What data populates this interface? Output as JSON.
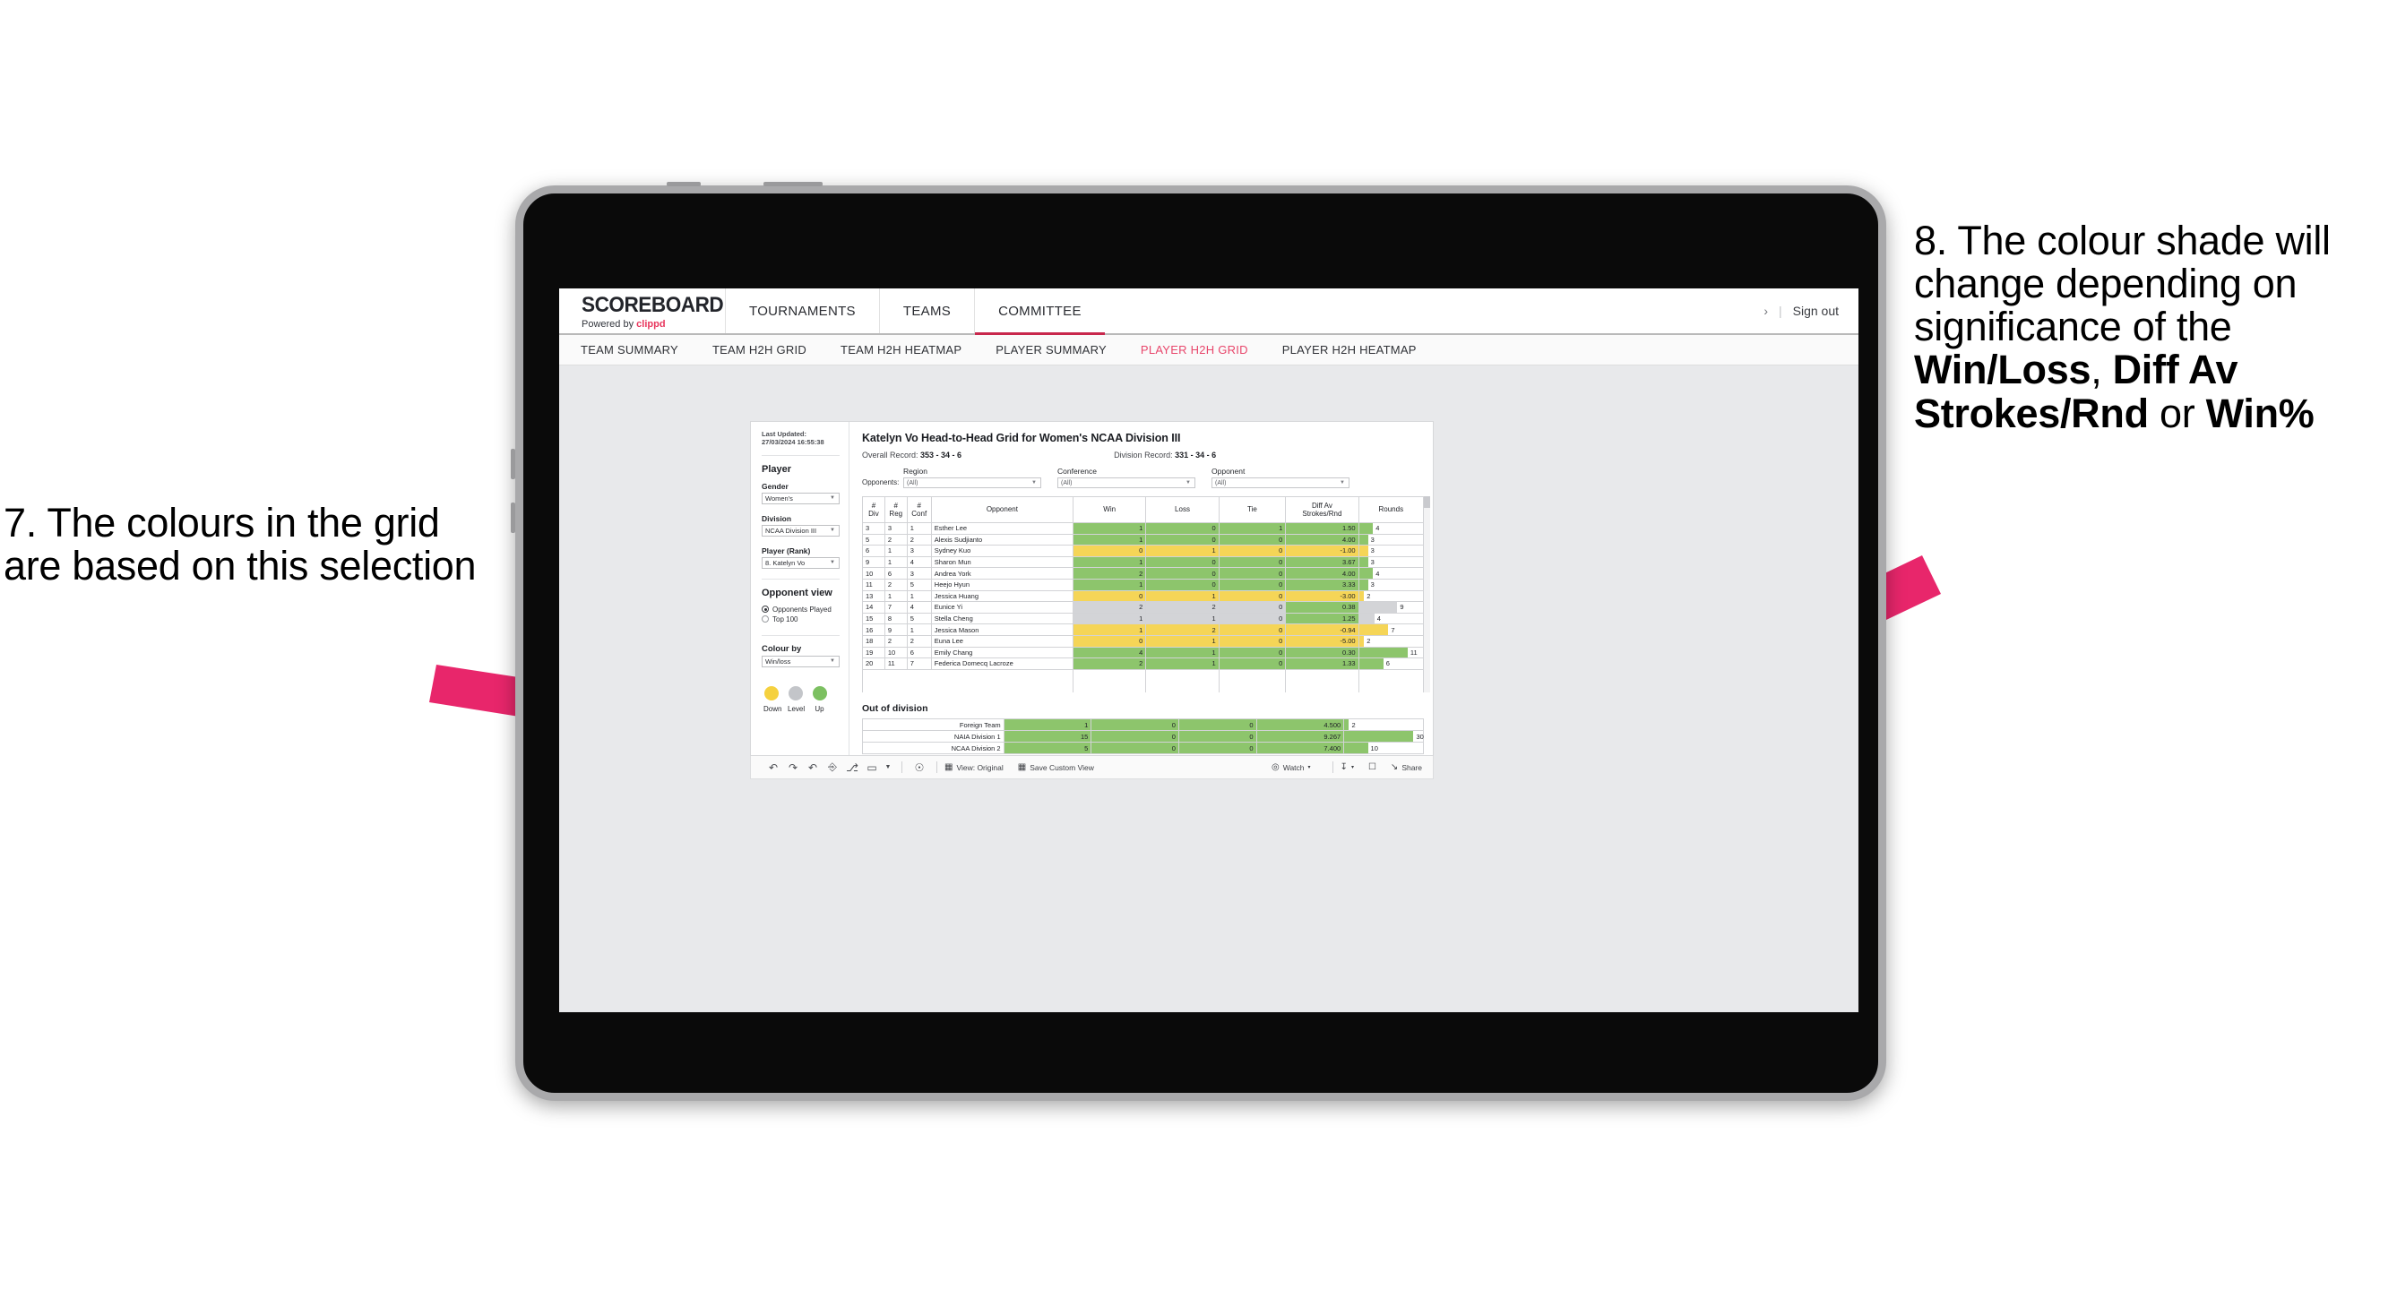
{
  "annotations": {
    "left": {
      "text": "7. The colours in the grid are based on this selection"
    },
    "right": {
      "line1": "8. The colour shade will change depending on significance of the ",
      "bold1": "Win/Loss",
      "mid1": ", ",
      "bold2": "Diff Av Strokes/Rnd",
      "mid2": " or ",
      "bold3": "Win%"
    }
  },
  "app": {
    "brand": {
      "title": "SCOREBOARD",
      "powered_by": "Powered by ",
      "clippd": "clippd"
    },
    "top_nav": [
      {
        "label": "TOURNAMENTS",
        "active": false
      },
      {
        "label": "TEAMS",
        "active": false
      },
      {
        "label": "COMMITTEE",
        "active": true
      }
    ],
    "header_right": {
      "chevron": "›",
      "pipe": "|",
      "sign_out": "Sign out"
    },
    "sub_nav": [
      {
        "label": "TEAM SUMMARY",
        "active": false
      },
      {
        "label": "TEAM H2H GRID",
        "active": false
      },
      {
        "label": "TEAM H2H HEATMAP",
        "active": false
      },
      {
        "label": "PLAYER SUMMARY",
        "active": false
      },
      {
        "label": "PLAYER H2H GRID",
        "active": true
      },
      {
        "label": "PLAYER H2H HEATMAP",
        "active": false
      }
    ]
  },
  "sidebar": {
    "last_updated": "Last Updated: 27/03/2024 16:55:38",
    "player_heading": "Player",
    "filters": [
      {
        "label": "Gender",
        "value": "Women's"
      },
      {
        "label": "Division",
        "value": "NCAA Division III"
      },
      {
        "label": "Player (Rank)",
        "value": "8. Katelyn Vo"
      }
    ],
    "opponent_view": {
      "heading": "Opponent view",
      "options": [
        {
          "label": "Opponents Played",
          "selected": true
        },
        {
          "label": "Top 100",
          "selected": false
        }
      ]
    },
    "colour_by": {
      "label": "Colour by",
      "value": "Win/loss"
    },
    "legend": [
      {
        "label": "Down",
        "color": "#f5d13f"
      },
      {
        "label": "Level",
        "color": "#c3c5c9"
      },
      {
        "label": "Up",
        "color": "#7cc061"
      }
    ]
  },
  "main": {
    "title": "Katelyn Vo Head-to-Head Grid for Women's NCAA Division III",
    "overall_record_label": "Overall Record: ",
    "overall_record_value": "353 -  34 - 6",
    "division_record_label": "Division Record: ",
    "division_record_value": "331 -  34 - 6",
    "opponents_label": "Opponents:",
    "opponent_filters": [
      {
        "label": "Region",
        "value": "(All)"
      },
      {
        "label": "Conference",
        "value": "(All)"
      },
      {
        "label": "Opponent",
        "value": "(All)"
      }
    ],
    "table_headers": [
      "#\nDiv",
      "#\nReg",
      "#\nConf",
      "Opponent",
      "Win",
      "Loss",
      "Tie",
      "Diff Av\nStrokes/Rnd",
      "Rounds"
    ],
    "rows": [
      {
        "div": "3",
        "reg": "3",
        "conf": "1",
        "opponent": "Esther Lee",
        "win": "1",
        "loss": "0",
        "tie": "1",
        "diff": "1.50",
        "rounds": "4",
        "fill": "#8dc56c",
        "bar_pct": 22
      },
      {
        "div": "5",
        "reg": "2",
        "conf": "2",
        "opponent": "Alexis Sudjianto",
        "win": "1",
        "loss": "0",
        "tie": "0",
        "diff": "4.00",
        "rounds": "3",
        "fill": "#8dc56c",
        "bar_pct": 14
      },
      {
        "div": "6",
        "reg": "1",
        "conf": "3",
        "opponent": "Sydney Kuo",
        "win": "0",
        "loss": "1",
        "tie": "0",
        "diff": "-1.00",
        "rounds": "3",
        "fill": "#f5d557",
        "bar_pct": 14
      },
      {
        "div": "9",
        "reg": "1",
        "conf": "4",
        "opponent": "Sharon Mun",
        "win": "1",
        "loss": "0",
        "tie": "0",
        "diff": "3.67",
        "rounds": "3",
        "fill": "#8dc56c",
        "bar_pct": 14
      },
      {
        "div": "10",
        "reg": "6",
        "conf": "3",
        "opponent": "Andrea York",
        "win": "2",
        "loss": "0",
        "tie": "0",
        "diff": "4.00",
        "rounds": "4",
        "fill": "#8dc56c",
        "bar_pct": 22
      },
      {
        "div": "11",
        "reg": "2",
        "conf": "5",
        "opponent": "Heejo Hyun",
        "win": "1",
        "loss": "0",
        "tie": "0",
        "diff": "3.33",
        "rounds": "3",
        "fill": "#8dc56c",
        "bar_pct": 14
      },
      {
        "div": "13",
        "reg": "1",
        "conf": "1",
        "opponent": "Jessica Huang",
        "win": "0",
        "loss": "1",
        "tie": "0",
        "diff": "-3.00",
        "rounds": "2",
        "fill": "#f5d557",
        "bar_pct": 8
      },
      {
        "div": "14",
        "reg": "7",
        "conf": "4",
        "opponent": "Eunice Yi",
        "win": "2",
        "loss": "2",
        "tie": "0",
        "diff": "0.38",
        "rounds": "9",
        "fill": "#d3d4d7",
        "bar_pct": 60,
        "diff_fill": "#8dc56c"
      },
      {
        "div": "15",
        "reg": "8",
        "conf": "5",
        "opponent": "Stella Cheng",
        "win": "1",
        "loss": "1",
        "tie": "0",
        "diff": "1.25",
        "rounds": "4",
        "fill": "#d3d4d7",
        "bar_pct": 24,
        "diff_fill": "#8dc56c"
      },
      {
        "div": "16",
        "reg": "9",
        "conf": "1",
        "opponent": "Jessica Mason",
        "win": "1",
        "loss": "2",
        "tie": "0",
        "diff": "-0.94",
        "rounds": "7",
        "fill": "#f5d557",
        "bar_pct": 46
      },
      {
        "div": "18",
        "reg": "2",
        "conf": "2",
        "opponent": "Euna Lee",
        "win": "0",
        "loss": "1",
        "tie": "0",
        "diff": "-5.00",
        "rounds": "2",
        "fill": "#f5d557",
        "bar_pct": 8
      },
      {
        "div": "19",
        "reg": "10",
        "conf": "6",
        "opponent": "Emily Chang",
        "win": "4",
        "loss": "1",
        "tie": "0",
        "diff": "0.30",
        "rounds": "11",
        "fill": "#8dc56c",
        "bar_pct": 76
      },
      {
        "div": "20",
        "reg": "11",
        "conf": "7",
        "opponent": "Federica Domecq Lacroze",
        "win": "2",
        "loss": "1",
        "tie": "0",
        "diff": "1.33",
        "rounds": "6",
        "fill": "#8dc56c",
        "bar_pct": 38
      }
    ],
    "out_of_division": {
      "title": "Out of division",
      "rows": [
        {
          "name": "Foreign Team",
          "win": "1",
          "loss": "0",
          "tie": "0",
          "diff": "4.500",
          "rounds": "2",
          "fill": "#8dc56c",
          "bar_pct": 6
        },
        {
          "name": "NAIA Division 1",
          "win": "15",
          "loss": "0",
          "tie": "0",
          "diff": "9.267",
          "rounds": "30",
          "fill": "#8dc56c",
          "bar_pct": 88
        },
        {
          "name": "NCAA Division 2",
          "win": "5",
          "loss": "0",
          "tie": "0",
          "diff": "7.400",
          "rounds": "10",
          "fill": "#8dc56c",
          "bar_pct": 30
        }
      ]
    }
  },
  "toolbar": {
    "icons": [
      "undo-icon",
      "redo-icon",
      "revert-icon",
      "refresh-icon",
      "pause-icon",
      "highlight-icon",
      "caret-icon"
    ],
    "glyphs": [
      "↶",
      "↷",
      "↺",
      "↻",
      "⏸",
      "▭",
      "▾"
    ],
    "alert_glyph": "☉",
    "view_label": "View: Original",
    "save_label": "Save Custom View",
    "watch_label": "Watch",
    "watch_caret": "▾",
    "download_caret": "▾",
    "share_label": "Share"
  },
  "colors": {
    "accent_pink": "#e8466b",
    "arrow_pink": "#e8266b",
    "green": "#8dc56c",
    "yellow": "#f5d557",
    "grey": "#d3d4d7"
  }
}
